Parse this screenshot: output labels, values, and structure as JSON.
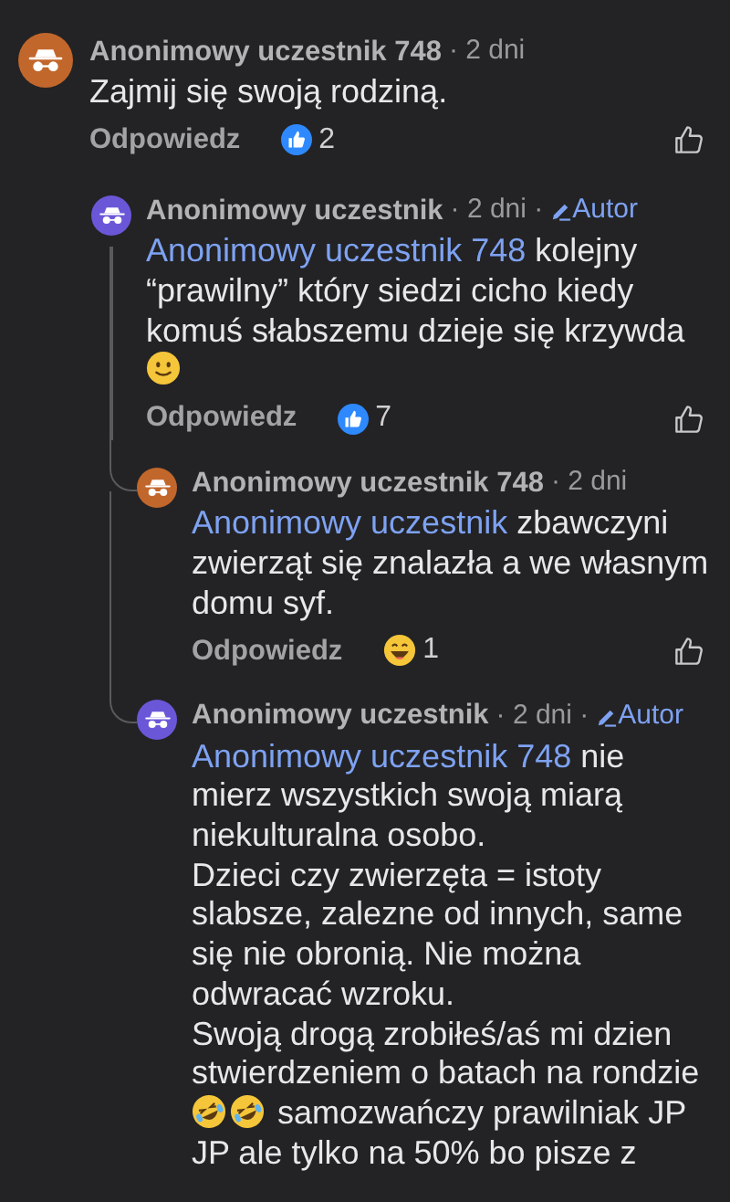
{
  "comments": [
    {
      "author": "Anonimowy uczestnik 748",
      "time": "· 2 dni",
      "color": "#c2672c",
      "body": [
        {
          "kind": "text",
          "text": "Zajmij się swoją rodziną."
        }
      ],
      "reply": "Odpowiedz",
      "reaction": {
        "kind": "like",
        "count": "2"
      },
      "children": [
        {
          "author": "Anonimowy uczestnik",
          "time": "· 2 dni ·",
          "badge": "Autor",
          "color": "#6a57d8",
          "body": [
            {
              "kind": "mention",
              "text": "Anonimowy uczestnik 748"
            },
            {
              "kind": "text",
              "text": " kolejny “prawilny” który siedzi cicho kiedy komuś słabszemu dzieje się krzywda "
            },
            {
              "kind": "smile"
            }
          ],
          "reply": "Odpowiedz",
          "reaction": {
            "kind": "like",
            "count": "7"
          },
          "children": [
            {
              "author": "Anonimowy uczestnik 748",
              "time": "· 2 dni",
              "color": "#c2672c",
              "body": [
                {
                  "kind": "mention",
                  "text": "Anonimowy uczestnik"
                },
                {
                  "kind": "text",
                  "text": " zbawczyni zwierząt się znalazła  a we własnym domu syf."
                }
              ],
              "reply": "Odpowiedz",
              "reaction": {
                "kind": "laugh",
                "count": "1"
              }
            },
            {
              "author": "Anonimowy uczestnik",
              "time": "· 2 dni ·",
              "badge": "Autor",
              "color": "#6a57d8",
              "body": [
                {
                  "kind": "mention",
                  "text": "Anonimowy uczestnik 748"
                },
                {
                  "kind": "text",
                  "text": " nie mierz wszystkich swoją miarą niekulturalna osobo.\nDzieci czy zwierzęta = istoty slabsze, zalezne od innych, same się nie obronią. Nie można odwracać wzroku.\nSwoją drogą zrobiłeś/aś mi dzien stwierdzeniem o batach na rondzie "
                },
                {
                  "kind": "rofl"
                },
                {
                  "kind": "rofl"
                },
                {
                  "kind": "text",
                  "text": " samozwańczy prawilniak JP JP ale tylko na 50% bo pisze z"
                }
              ]
            }
          ]
        }
      ]
    }
  ]
}
